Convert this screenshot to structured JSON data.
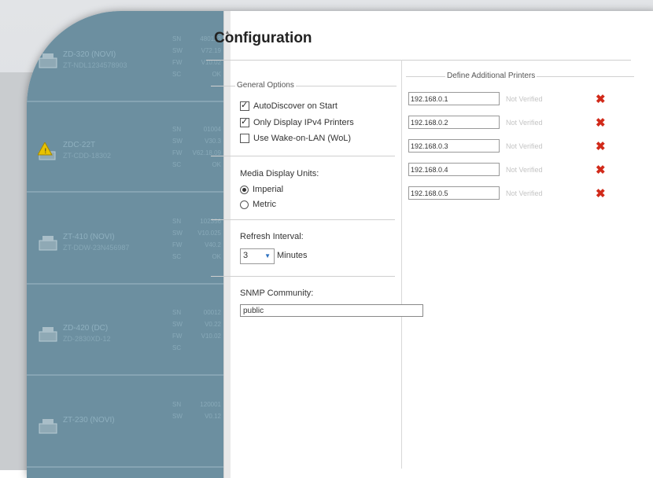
{
  "title": "Configuration",
  "printer_list": [
    {
      "name": "ZD-320 (NOVI)",
      "sub": "ZT-NDL1234578903",
      "codes": [
        "SN",
        "SW",
        "FW",
        "SC"
      ],
      "vals": [
        "480123",
        "V72.19",
        "V10.02",
        "OK"
      ],
      "status": "ok"
    },
    {
      "name": "ZDC-22T",
      "sub": "ZT-CDD-18302",
      "codes": [
        "SN",
        "SW",
        "FW",
        "SC"
      ],
      "vals": [
        "01004",
        "V30.3",
        "V62.18.09",
        "OK"
      ],
      "status": "warning"
    },
    {
      "name": "ZT-410 (NOVI)",
      "sub": "ZT-DDW-23N456987",
      "codes": [
        "SN",
        "SW",
        "FW",
        "SC"
      ],
      "vals": [
        "102356",
        "V10.025",
        "V40.2",
        "OK"
      ],
      "status": "ok"
    },
    {
      "name": "ZD-420 (DC)",
      "sub": "ZD-2830XD-12",
      "codes": [
        "SN",
        "SW",
        "FW",
        "SC"
      ],
      "vals": [
        "00012",
        "V0.22",
        "V10.02",
        ""
      ],
      "status": "ok"
    },
    {
      "name": "ZT-230 (NOVI)",
      "sub": "",
      "codes": [
        "SN",
        "SW"
      ],
      "vals": [
        "120001",
        "V0.12"
      ],
      "status": "ok"
    }
  ],
  "general": {
    "legend": "General Options",
    "autodiscover": "AutoDiscover on Start",
    "ipv4": "Only Display IPv4 Printers",
    "wol": "Use Wake-on-LAN (WoL)",
    "media_units_label": "Media Display Units:",
    "imperial": "Imperial",
    "metric": "Metric",
    "refresh_label": "Refresh Interval:",
    "refresh_value": "3",
    "refresh_unit": "Minutes",
    "snmp_label": "SNMP Community:",
    "snmp_value": "public"
  },
  "additional": {
    "legend": "Define Additional Printers",
    "printers": [
      {
        "ip": "192.168.0.1",
        "status": "Not Verified"
      },
      {
        "ip": "192.168.0.2",
        "status": "Not Verified"
      },
      {
        "ip": "192.168.0.3",
        "status": "Not Verified"
      },
      {
        "ip": "192.168.0.4",
        "status": "Not Verified"
      },
      {
        "ip": "192.168.0.5",
        "status": "Not Verified"
      }
    ],
    "delete_glyph": "✖"
  },
  "colors": {
    "delete": "#d12a1a",
    "list_bg": "#6c8fa0"
  }
}
